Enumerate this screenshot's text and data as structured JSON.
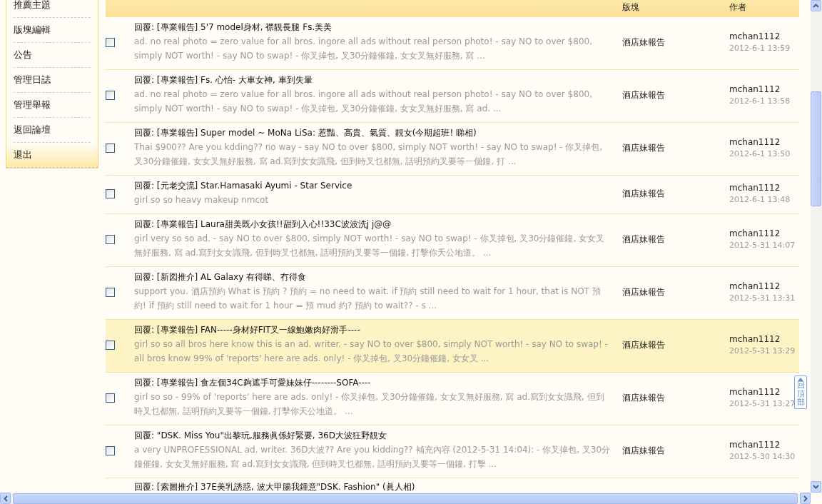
{
  "sidebar": {
    "items": [
      {
        "label": "推薦主題",
        "selected": false
      },
      {
        "label": "版塊編輯",
        "selected": false
      },
      {
        "label": "公告",
        "selected": false
      },
      {
        "label": "管理日誌",
        "selected": false
      },
      {
        "label": "管理舉報",
        "selected": false
      },
      {
        "label": "返回論壇",
        "selected": false
      },
      {
        "label": "退出",
        "selected": true
      }
    ]
  },
  "table": {
    "columns": [
      "版塊",
      "作者"
    ],
    "rows": [
      {
        "checked": false,
        "highlighted": false,
        "title": "回覆: [專業報告] 5'7 model身材, 襟靚長腿 Fs.美美",
        "excerpt": "ad. no real photo = zero value for all bros. ingore all ads without real person photo! - say NO to over $800, simply NOT worth! - say NO to swap! - 你叉掉包, 叉30分鐘催鐘, 女女叉無好服務, 寫 ...",
        "board": "酒店妹報告",
        "author": "mchan1112",
        "time": "2012-6-1 13:59"
      },
      {
        "checked": false,
        "highlighted": false,
        "title": "回覆: [專業報告] Fs. 心怡- 大車女神, 車到失暈",
        "excerpt": "ad. no real photo = zero value for all bros. ingore all ads without real person photo! - say NO to over $800, simply NOT worth! - say NO to swap! - 你叉掉包, 叉30分鐘催鐘, 女女叉無好服務, 寫 ad. ...",
        "board": "酒店妹報告",
        "author": "mchan1112",
        "time": "2012-6-1 13:58"
      },
      {
        "checked": false,
        "highlighted": false,
        "title": "回覆: [專業報告] Super model ~ MoNa LiSa: 惹豔、高貴、氣質、靚女(今期超班! 睇相)",
        "excerpt": "Thai $900?? Are you kdding?? no way - say NO to over $800, simply NOT worth! - say NO to swap! - 你叉掉包, 叉30分鐘催鐘, 女女叉無好服務, 寫 ad.寫到女女識飛, 但到時叉乜都無, 話明預約叉要等一個鐘, 打 ...",
        "board": "酒店妹報告",
        "author": "mchan1112",
        "time": "2012-6-1 13:50"
      },
      {
        "checked": false,
        "highlighted": false,
        "title": "回覆: [元老交流] Star.Hamasaki Ayumi - Star Service",
        "excerpt": "girl so so heavy makeup nmcot",
        "board": "酒店妹報告",
        "author": "mchan1112",
        "time": "2012-6-1 13:48"
      },
      {
        "checked": false,
        "highlighted": false,
        "title": "回覆: [專業報告] Laura甜美既小女孩!!甜到入心!!33C波波洗j j@@",
        "excerpt": "girl very so so ad. - say NO to over $800, simply NOT worth! - say NO to swap! - 你叉掉包, 叉30分鐘催鐘, 女女叉無好服務, 寫 ad.寫到女女識飛, 但到時叉乜都無, 話明預約叉要等一個鐘, 打擊你夭公地道。 ...",
        "board": "酒店妹報告",
        "author": "mchan1112",
        "time": "2012-5-31 14:07"
      },
      {
        "checked": false,
        "highlighted": false,
        "title": "回覆: [新図推介] AL Galaxy 有得睇、冇得食",
        "excerpt": "support you. 酒店預約 What is 預約 ? 預約 = no need to wait. if 預約 still need to wait for 1 hour, that is NOT 預約! if 預約 still need to wait for 1 hour = 預 mud 約? 預約 to wait?? - s ...",
        "board": "酒店妹報告",
        "author": "mchan1112",
        "time": "2012-5-31 13:31"
      },
      {
        "checked": false,
        "highlighted": true,
        "title": "回覆: [專業報告] FAN-----身材好FIT叉一線鮑嫩肉好滑手----",
        "excerpt": "girl so so all bros here know this is an ad. writer. - say NO to over $800, simply NOT worth! - say NO to swap! - all bros know 99% of 'reports' here are ads. only! - 你叉掉包, 叉30分鐘催鐘, 女女叉 ...",
        "board": "酒店妹報告",
        "author": "mchan1112",
        "time": "2012-5-31 13:29"
      },
      {
        "checked": false,
        "highlighted": false,
        "title": "回覆: [專業報告] 食左個34C夠遮手可愛妹妹仔--------SOFA----",
        "excerpt": "girl so so - 99% of 'reports' here are ads. only! - 你叉掉包, 叉30分鐘催鐘, 女女叉無好服務, 寫 ad.寫到女女識飛, 但到時叉乜都無, 話明預約叉要等一個鐘, 打擊你夭公地道。 ...",
        "board": "酒店妹報告",
        "author": "mchan1112",
        "time": "2012-5-31 13:27"
      },
      {
        "checked": false,
        "highlighted": false,
        "title": "回覆: \"DSK. Miss You\"出黎玩,服務眞係好緊要, 36D大波狂野靚女",
        "excerpt": "a very UNPROFESSIONAL ad. writer. 36D大波?? Are you kidding?? 補充內容 (2012-5-31 14:04): - 你叉掉包, 叉30分鐘催鐘, 女女叉無好服務, 寫 ad.寫到女女識飛, 但到時叉乜都無, 話明預約叉要等一個鐘, 打擊 ...",
        "board": "酒店妹報告",
        "author": "mchan1112",
        "time": "2012-5-30 14:30"
      },
      {
        "highlighted": false,
        "title": "回覆: [索圖推介] 37E美乳誘惑, 波大甲腸我鍾意\"DSK. Fashion\" (眞人相)"
      }
    ]
  },
  "back_to_top": {
    "label": "回頂部"
  }
}
